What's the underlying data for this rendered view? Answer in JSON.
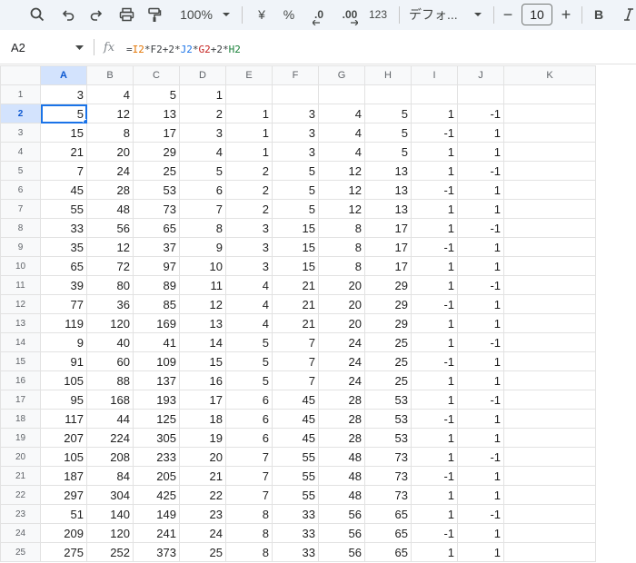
{
  "toolbar": {
    "zoom": "100%",
    "currency": "¥",
    "percent": "%",
    "dec_decrease": ".0",
    "dec_increase": ".00",
    "format_123": "123",
    "font": "デフォ...",
    "minus": "−",
    "font_size": "10",
    "plus": "+",
    "bold": "B"
  },
  "formula_bar": {
    "name_box": "A2",
    "fx": "fx",
    "formula_parts": [
      {
        "text": "=",
        "color": "#3c4043"
      },
      {
        "text": "I2",
        "color": "#e37400"
      },
      {
        "text": "*",
        "color": "#3c4043"
      },
      {
        "text": "F2",
        "color": "#3c4043"
      },
      {
        "text": "+2*",
        "color": "#3c4043"
      },
      {
        "text": "J2",
        "color": "#1a73e8"
      },
      {
        "text": "*",
        "color": "#3c4043"
      },
      {
        "text": "G2",
        "color": "#c5221f"
      },
      {
        "text": "+2*",
        "color": "#3c4043"
      },
      {
        "text": "H2",
        "color": "#188038"
      }
    ]
  },
  "sheet": {
    "columns": [
      "A",
      "B",
      "C",
      "D",
      "E",
      "F",
      "G",
      "H",
      "I",
      "J",
      "K"
    ],
    "selected_column": "A",
    "selected_row": "2",
    "rows": [
      {
        "n": "1",
        "cells": [
          "3",
          "4",
          "5",
          "1",
          "",
          "",
          "",
          "",
          "",
          "",
          ""
        ]
      },
      {
        "n": "2",
        "cells": [
          "5",
          "12",
          "13",
          "2",
          "1",
          "3",
          "4",
          "5",
          "1",
          "-1",
          ""
        ]
      },
      {
        "n": "3",
        "cells": [
          "15",
          "8",
          "17",
          "3",
          "1",
          "3",
          "4",
          "5",
          "-1",
          "1",
          ""
        ]
      },
      {
        "n": "4",
        "cells": [
          "21",
          "20",
          "29",
          "4",
          "1",
          "3",
          "4",
          "5",
          "1",
          "1",
          ""
        ]
      },
      {
        "n": "5",
        "cells": [
          "7",
          "24",
          "25",
          "5",
          "2",
          "5",
          "12",
          "13",
          "1",
          "-1",
          ""
        ]
      },
      {
        "n": "6",
        "cells": [
          "45",
          "28",
          "53",
          "6",
          "2",
          "5",
          "12",
          "13",
          "-1",
          "1",
          ""
        ]
      },
      {
        "n": "7",
        "cells": [
          "55",
          "48",
          "73",
          "7",
          "2",
          "5",
          "12",
          "13",
          "1",
          "1",
          ""
        ]
      },
      {
        "n": "8",
        "cells": [
          "33",
          "56",
          "65",
          "8",
          "3",
          "15",
          "8",
          "17",
          "1",
          "-1",
          ""
        ]
      },
      {
        "n": "9",
        "cells": [
          "35",
          "12",
          "37",
          "9",
          "3",
          "15",
          "8",
          "17",
          "-1",
          "1",
          ""
        ]
      },
      {
        "n": "10",
        "cells": [
          "65",
          "72",
          "97",
          "10",
          "3",
          "15",
          "8",
          "17",
          "1",
          "1",
          ""
        ]
      },
      {
        "n": "11",
        "cells": [
          "39",
          "80",
          "89",
          "11",
          "4",
          "21",
          "20",
          "29",
          "1",
          "-1",
          ""
        ]
      },
      {
        "n": "12",
        "cells": [
          "77",
          "36",
          "85",
          "12",
          "4",
          "21",
          "20",
          "29",
          "-1",
          "1",
          ""
        ]
      },
      {
        "n": "13",
        "cells": [
          "119",
          "120",
          "169",
          "13",
          "4",
          "21",
          "20",
          "29",
          "1",
          "1",
          ""
        ]
      },
      {
        "n": "14",
        "cells": [
          "9",
          "40",
          "41",
          "14",
          "5",
          "7",
          "24",
          "25",
          "1",
          "-1",
          ""
        ]
      },
      {
        "n": "15",
        "cells": [
          "91",
          "60",
          "109",
          "15",
          "5",
          "7",
          "24",
          "25",
          "-1",
          "1",
          ""
        ]
      },
      {
        "n": "16",
        "cells": [
          "105",
          "88",
          "137",
          "16",
          "5",
          "7",
          "24",
          "25",
          "1",
          "1",
          ""
        ]
      },
      {
        "n": "17",
        "cells": [
          "95",
          "168",
          "193",
          "17",
          "6",
          "45",
          "28",
          "53",
          "1",
          "-1",
          ""
        ]
      },
      {
        "n": "18",
        "cells": [
          "117",
          "44",
          "125",
          "18",
          "6",
          "45",
          "28",
          "53",
          "-1",
          "1",
          ""
        ]
      },
      {
        "n": "19",
        "cells": [
          "207",
          "224",
          "305",
          "19",
          "6",
          "45",
          "28",
          "53",
          "1",
          "1",
          ""
        ]
      },
      {
        "n": "20",
        "cells": [
          "105",
          "208",
          "233",
          "20",
          "7",
          "55",
          "48",
          "73",
          "1",
          "-1",
          ""
        ]
      },
      {
        "n": "21",
        "cells": [
          "187",
          "84",
          "205",
          "21",
          "7",
          "55",
          "48",
          "73",
          "-1",
          "1",
          ""
        ]
      },
      {
        "n": "22",
        "cells": [
          "297",
          "304",
          "425",
          "22",
          "7",
          "55",
          "48",
          "73",
          "1",
          "1",
          ""
        ]
      },
      {
        "n": "23",
        "cells": [
          "51",
          "140",
          "149",
          "23",
          "8",
          "33",
          "56",
          "65",
          "1",
          "-1",
          ""
        ]
      },
      {
        "n": "24",
        "cells": [
          "209",
          "120",
          "241",
          "24",
          "8",
          "33",
          "56",
          "65",
          "-1",
          "1",
          ""
        ]
      },
      {
        "n": "25",
        "cells": [
          "275",
          "252",
          "373",
          "25",
          "8",
          "33",
          "56",
          "65",
          "1",
          "1",
          ""
        ]
      }
    ]
  }
}
